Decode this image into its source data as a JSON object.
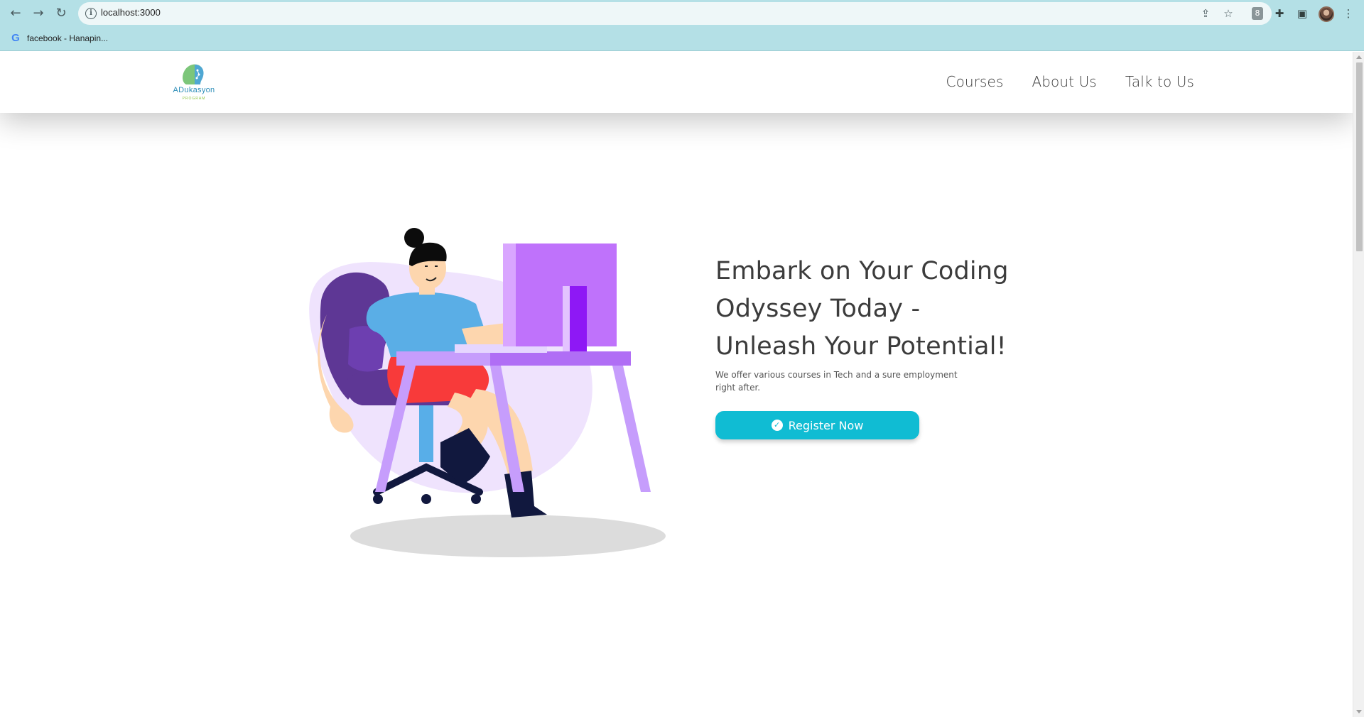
{
  "browser": {
    "url": "localhost:3000",
    "bookmark_label": "facebook - Hanapin...",
    "extension_badge": "8"
  },
  "header": {
    "logo_text": "ADukasyon",
    "logo_sub": "PROGRAM",
    "nav": [
      "Courses",
      "About Us",
      "Talk to Us"
    ]
  },
  "hero": {
    "title_lines": [
      "Embark on Your Coding",
      "Odyssey Today -",
      "Unleash Your Potential!"
    ],
    "description": "We offer various courses in Tech and a sure employment right after.",
    "cta_label": "Register Now"
  },
  "colors": {
    "chrome": "#b4e0e6",
    "accent": "#10bcd3",
    "purple": "#bf72fb"
  }
}
